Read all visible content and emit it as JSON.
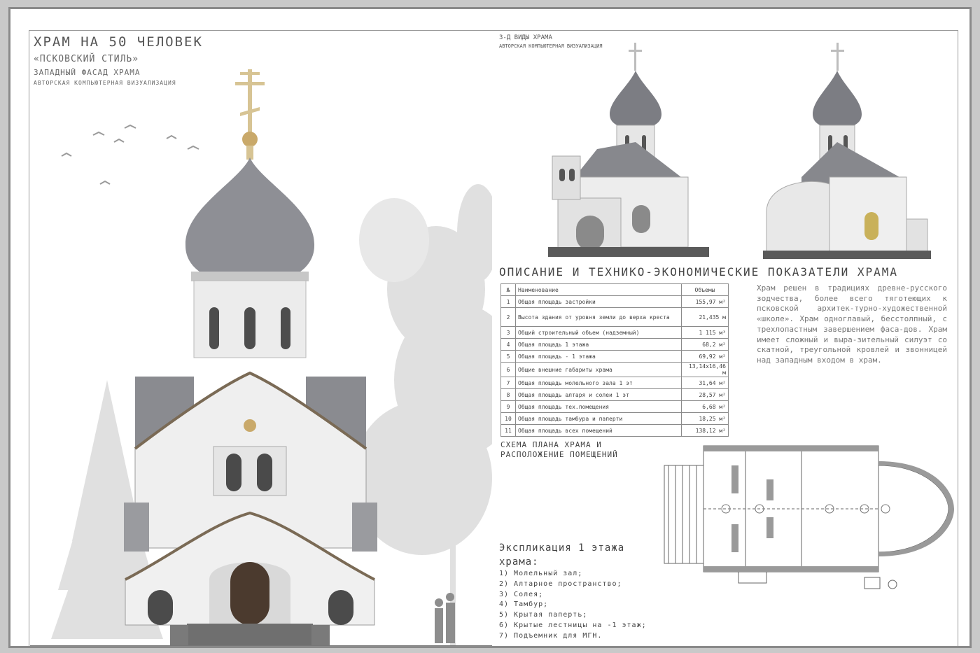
{
  "sheet": {
    "title": "ХРАМ НА 50 ЧЕЛОВЕК",
    "style_label": "«ПСКОВСКИЙ СТИЛЬ»",
    "facade_label": "ЗАПАДНЫЙ ФАСАД ХРАМА",
    "author_label": "АВТОРСКАЯ КОМПЬЮТЕРНАЯ ВИЗУАЛИЗАЦИЯ"
  },
  "views3d": {
    "title": "3-Д ВИДЫ ХРАМА",
    "subtitle": "АВТОРСКАЯ КОМПЬЮТЕРНАЯ ВИЗУАЛИЗАЦИЯ"
  },
  "description": {
    "title": "ОПИСАНИЕ И ТЕХНИКО-ЭКОНОМИЧЕСКИЕ ПОКАЗАТЕЛИ ХРАМА",
    "text": "Храм решен в традициях древне-русского зодчества, более всего тяготеющих к псковской архитек-турно-художественной «школе». Храм одноглавый, бесстолпный, с трехлопастным завершением фаса-дов. Храм имеет сложный и выра-зительный силуэт со скатной, треугольной кровлей и звонницей над западным входом в храм."
  },
  "table": {
    "header": [
      "№",
      "Наименование",
      "Объемы"
    ],
    "rows": [
      [
        "1",
        "Общая площадь застройки",
        "155,97 м²"
      ],
      [
        "2",
        "Высота здания от уровня земли до верха креста",
        "21,435 м"
      ],
      [
        "3",
        "Общий строительный объем (надземный)",
        "1 115 м³"
      ],
      [
        "4",
        "Общая площадь 1 этажа",
        "68,2 м²"
      ],
      [
        "5",
        "Общая площадь - 1 этажа",
        "69,92 м²"
      ],
      [
        "6",
        "Общие внешние габариты храма",
        "13,14х16,46 м"
      ],
      [
        "7",
        "Общая площадь молельного зала 1 эт",
        "31,64 м²"
      ],
      [
        "8",
        "Общая площадь алтаря и солеи 1 эт",
        "28,57 м²"
      ],
      [
        "9",
        "Общая площадь тех.помещения",
        "6,68 м²"
      ],
      [
        "10",
        "Общая площадь тамбура и паперти",
        "18,25 м²"
      ],
      [
        "11",
        "Общая площадь всех помещений",
        "138,12 м²"
      ]
    ]
  },
  "plan": {
    "title": "СХЕМА ПЛАНА ХРАМА И РАСПОЛОЖЕНИЕ ПОМЕЩЕНИЙ"
  },
  "explication": {
    "title": "Экспликация 1 этажа храма:",
    "items": [
      "1) Молельный зал;",
      "2) Алтарное пространство;",
      "3) Солея;",
      "4) Тамбур;",
      "5) Крытая паперть;",
      "6) Крытые лестницы на -1 этаж;",
      "7) Подъемник для МГН."
    ]
  }
}
